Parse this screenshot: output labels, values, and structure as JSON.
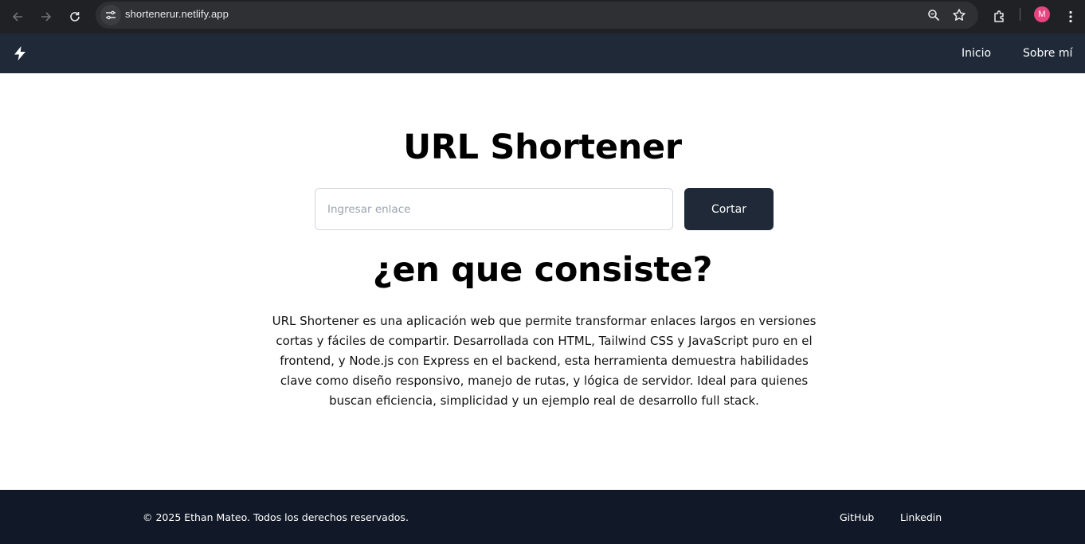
{
  "browser": {
    "url": "shortenerur.netlify.app",
    "profile_initial": "M",
    "icons": [
      "back-icon",
      "forward-icon",
      "reload-icon",
      "site-info-icon",
      "zoom-icon",
      "bookmark-star-icon",
      "extensions-icon",
      "menu-dots-icon"
    ]
  },
  "header": {
    "logo_icon": "lightning-bolt-icon",
    "nav": [
      {
        "label": "Inicio"
      },
      {
        "label": "Sobre mí"
      }
    ]
  },
  "main": {
    "title": "URL Shortener",
    "input_placeholder": "Ingresar enlace",
    "input_value": "",
    "button_label": "Cortar",
    "subtitle": "¿en que consiste?",
    "description": "URL Shortener es una aplicación web que permite transformar enlaces largos en versiones cortas y fáciles de compartir. Desarrollada con HTML, Tailwind CSS y JavaScript puro en el frontend, y Node.js con Express en el backend, esta herramienta demuestra habilidades clave como diseño responsivo, manejo de rutas, y lógica de servidor. Ideal para quienes buscan eficiencia, simplicidad y un ejemplo real de desarrollo full stack."
  },
  "footer": {
    "copyright": "© 2025 Ethan Mateo. Todos los derechos reservados.",
    "links": [
      {
        "label": "GitHub"
      },
      {
        "label": "Linkedin"
      }
    ]
  },
  "colors": {
    "header_bg": "#1f2937",
    "footer_bg": "#111827",
    "button_bg": "#1f2937",
    "browser_bg": "#202124",
    "avatar_bg": "#e8457f"
  }
}
